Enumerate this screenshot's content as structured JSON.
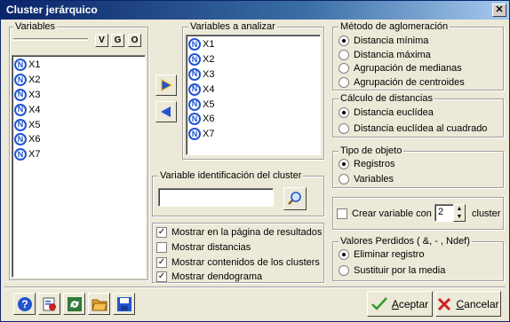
{
  "window": {
    "title": "Cluster jerárquico",
    "close": "✕"
  },
  "left_list": {
    "label": "Variables",
    "sort_buttons": [
      "V",
      "G",
      "O"
    ],
    "items": [
      "X1",
      "X2",
      "X3",
      "X4",
      "X5",
      "X6",
      "X7"
    ]
  },
  "right_list": {
    "label": "Variables a analizar",
    "items": [
      "X1",
      "X2",
      "X3",
      "X4",
      "X5",
      "X6",
      "X7"
    ]
  },
  "id_var": {
    "label": "Variable identificación del cluster",
    "value": ""
  },
  "options": [
    {
      "label": "Mostrar en la página de resultados",
      "checked": true
    },
    {
      "label": "Mostrar distancias",
      "checked": false
    },
    {
      "label": "Mostrar contenidos de los clusters",
      "checked": true
    },
    {
      "label": "Mostrar dendograma",
      "checked": true
    }
  ],
  "method": {
    "label": "Método de aglomeración",
    "items": [
      "Distancia mínima",
      "Distancia máxima",
      "Agrupación de medianas",
      "Agrupación de centroides"
    ],
    "selected": 0
  },
  "distance": {
    "label": "Cálculo de distancias",
    "items": [
      "Distancia euclídea",
      "Distancia euclídea al cuadrado"
    ],
    "selected": 0
  },
  "object_type": {
    "label": "Tipo de objeto",
    "items": [
      "Registros",
      "Variables"
    ],
    "selected": 0
  },
  "create_var": {
    "label": "Crear variable con",
    "value": "2",
    "suffix": "cluster",
    "checked": false
  },
  "missing": {
    "label": "Valores Perdidos ( &, - , Ndef)",
    "items": [
      "Eliminar registro",
      "Sustituir por la media"
    ],
    "selected": 0
  },
  "buttons": {
    "accept_first": "A",
    "accept_rest": "ceptar",
    "cancel_first": "C",
    "cancel_rest": "ancelar"
  },
  "colors": {
    "title_start": "#0a246a",
    "accent_blue": "#2255cc",
    "accept_green": "#2e9a2e",
    "cancel_red": "#cc2222"
  }
}
